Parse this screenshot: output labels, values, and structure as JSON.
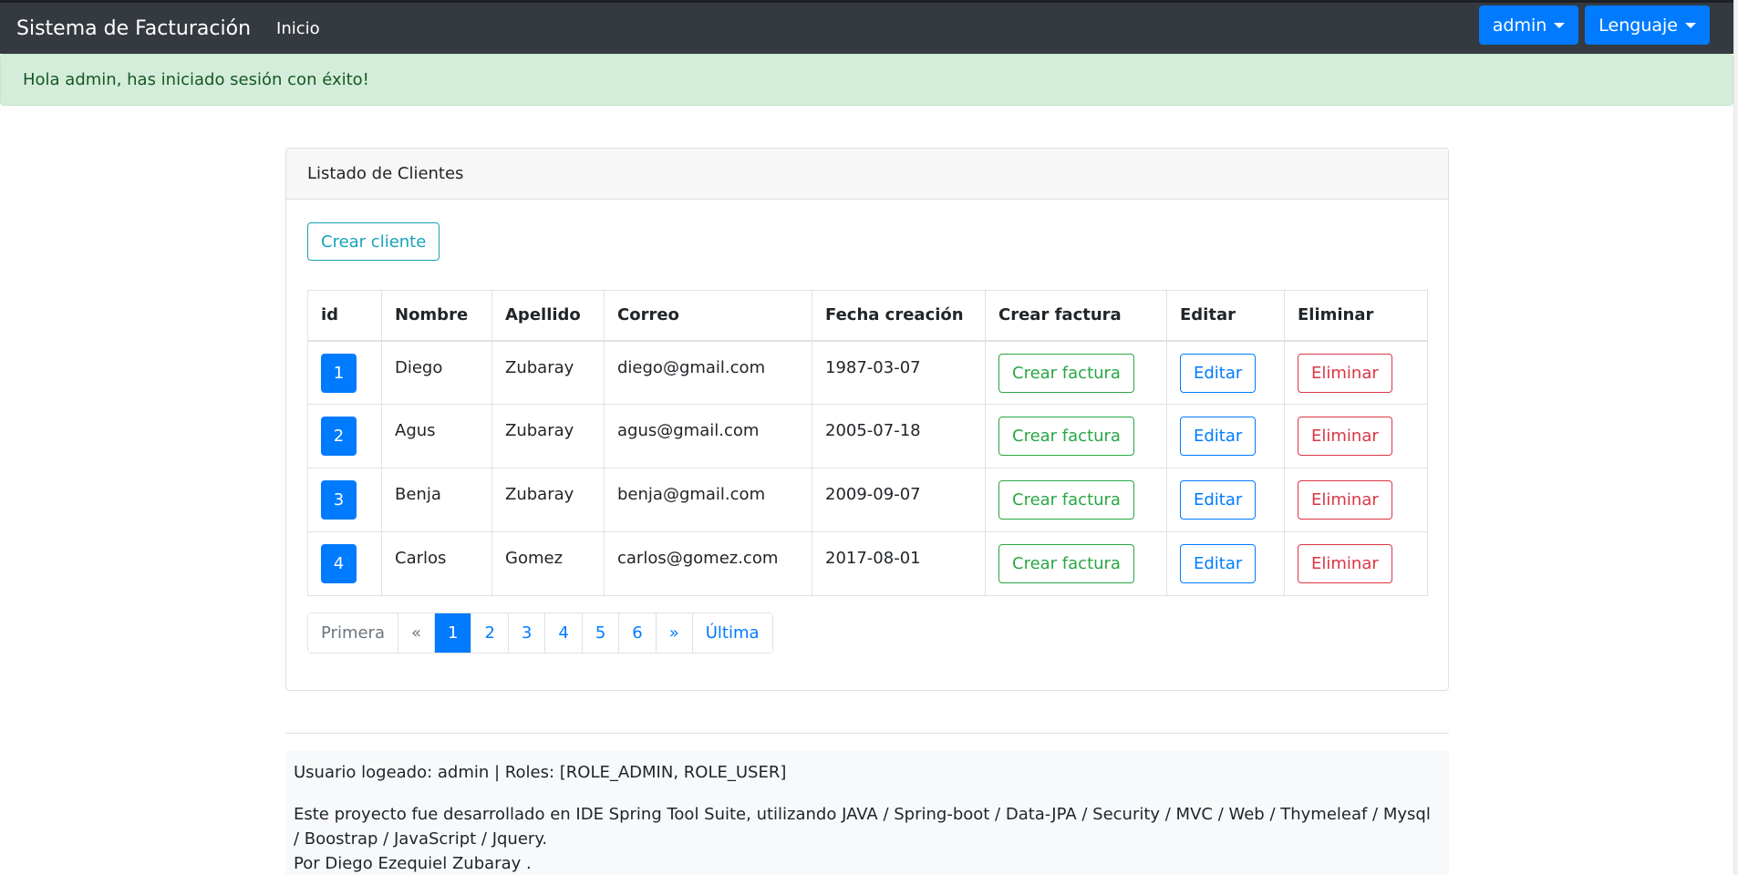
{
  "navbar": {
    "brand": "Sistema de Facturación",
    "home_link": "Inicio",
    "user_menu": "admin",
    "language_menu": "Lenguaje"
  },
  "alert": {
    "message": "Hola admin, has iniciado sesión con éxito!"
  },
  "card": {
    "title": "Listado de Clientes",
    "create_button": "Crear cliente"
  },
  "table": {
    "headers": [
      "id",
      "Nombre",
      "Apellido",
      "Correo",
      "Fecha creación",
      "Crear factura",
      "Editar",
      "Eliminar"
    ],
    "rows": [
      {
        "id": "1",
        "nombre": "Diego",
        "apellido": "Zubaray",
        "correo": "diego@gmail.com",
        "fecha": "1987-03-07"
      },
      {
        "id": "2",
        "nombre": "Agus",
        "apellido": "Zubaray",
        "correo": "agus@gmail.com",
        "fecha": "2005-07-18"
      },
      {
        "id": "3",
        "nombre": "Benja",
        "apellido": "Zubaray",
        "correo": "benja@gmail.com",
        "fecha": "2009-09-07"
      },
      {
        "id": "4",
        "nombre": "Carlos",
        "apellido": "Gomez",
        "correo": "carlos@gomez.com",
        "fecha": "2017-08-01"
      }
    ],
    "invoice_label": "Crear factura",
    "edit_label": "Editar",
    "delete_label": "Eliminar"
  },
  "pagination": {
    "first": "Primera",
    "prev": "«",
    "pages": [
      "1",
      "2",
      "3",
      "4",
      "5",
      "6"
    ],
    "next": "»",
    "last": "Última",
    "current": "1"
  },
  "footer": {
    "user_info": "Usuario logeado: admin | Roles: [ROLE_ADMIN, ROLE_USER]",
    "description": "Este proyecto fue desarrollado en IDE Spring Tool Suite, utilizando JAVA / Spring-boot / Data-JPA / Security / MVC / Web / Thymeleaf / Mysql / Boostrap / JavaScript / Jquery.",
    "author": "Por Diego Ezequiel Zubaray ."
  },
  "colors": {
    "navbar_bg": "#343a40",
    "primary": "#007bff",
    "success": "#28a745",
    "danger": "#dc3545",
    "info": "#17a2b8",
    "alert_bg": "#d4edda"
  }
}
